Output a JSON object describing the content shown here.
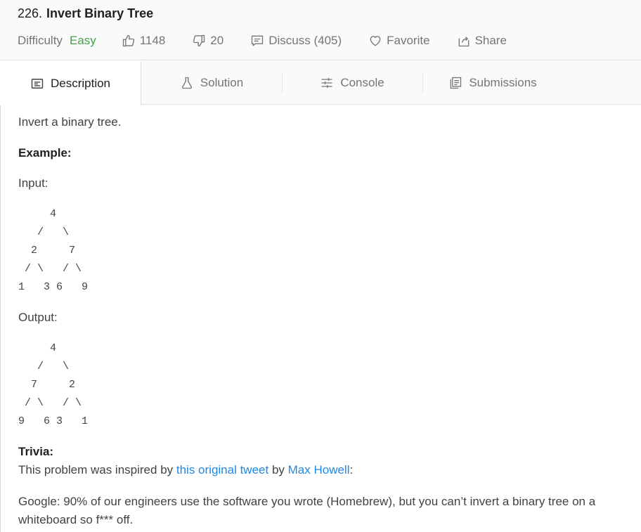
{
  "problem": {
    "number": "226.",
    "title": "Invert Binary Tree",
    "difficulty_label": "Difficulty",
    "difficulty": "Easy",
    "likes": "1148",
    "dislikes": "20",
    "discuss": "Discuss (405)",
    "favorite": "Favorite",
    "share": "Share"
  },
  "tabs": [
    {
      "label": "Description",
      "icon": "description-icon",
      "active": true
    },
    {
      "label": "Solution",
      "icon": "flask-icon",
      "active": false
    },
    {
      "label": "Console",
      "icon": "sliders-icon",
      "active": false
    },
    {
      "label": "Submissions",
      "icon": "submissions-icon",
      "active": false
    }
  ],
  "body": {
    "intro": "Invert a binary tree.",
    "example_heading": "Example:",
    "input_label": "Input:",
    "input_tree": "     4\n   /   \\\n  2     7\n / \\   / \\\n1   3 6   9",
    "output_label": "Output:",
    "output_tree": "     4\n   /   \\\n  7     2\n / \\   / \\\n9   6 3   1",
    "trivia_heading": "Trivia:",
    "trivia_prefix": "This problem was inspired by ",
    "trivia_link1": "this original tweet",
    "trivia_mid": " by ",
    "trivia_link2": "Max Howell",
    "trivia_suffix": ":",
    "quote": "Google: 90% of our engineers use the software you wrote (Homebrew), but you can’t invert a binary tree on a whiteboard so f*** off."
  },
  "colors": {
    "easy": "#43a047",
    "link": "#1e88e5"
  }
}
